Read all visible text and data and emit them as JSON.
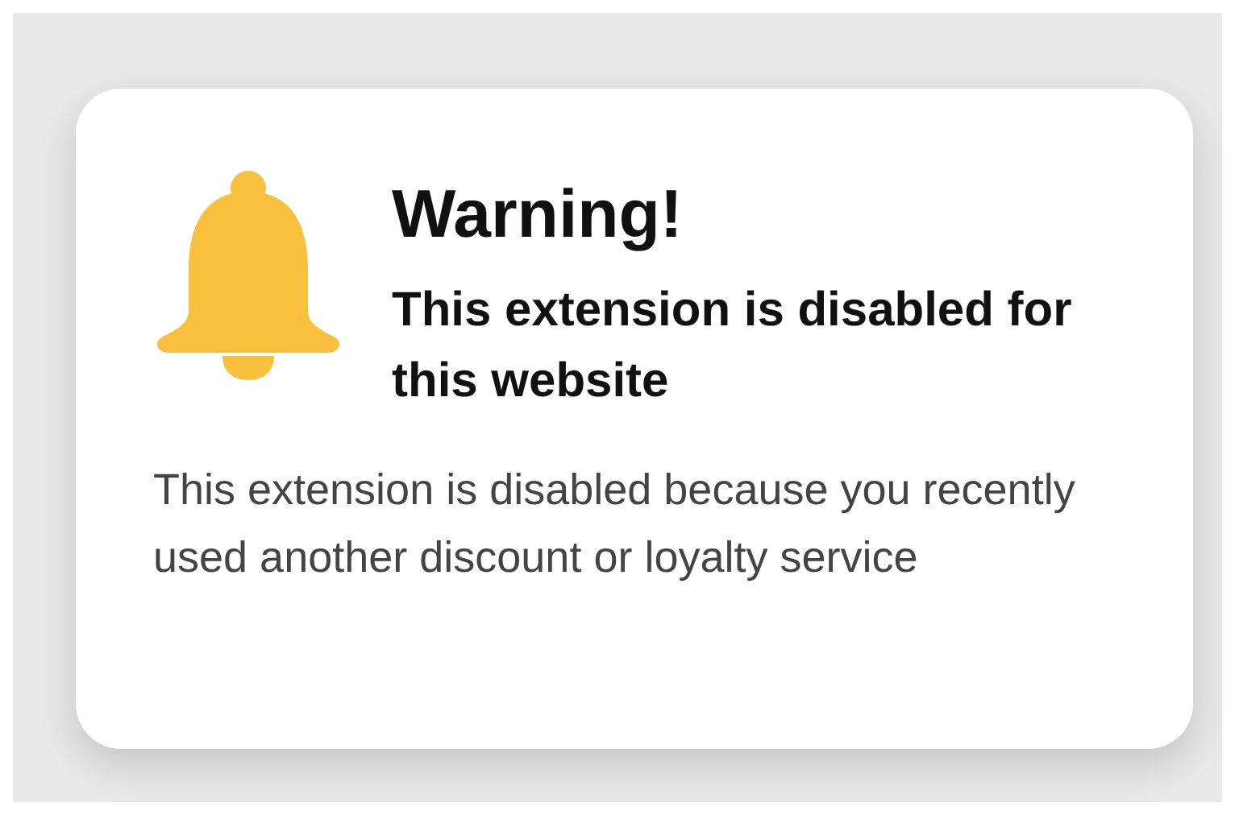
{
  "dialog": {
    "title": "Warning!",
    "subtitle": "This extension is disabled for this website",
    "message": "This extension is disabled because you recently used another discount or loyalty service"
  }
}
